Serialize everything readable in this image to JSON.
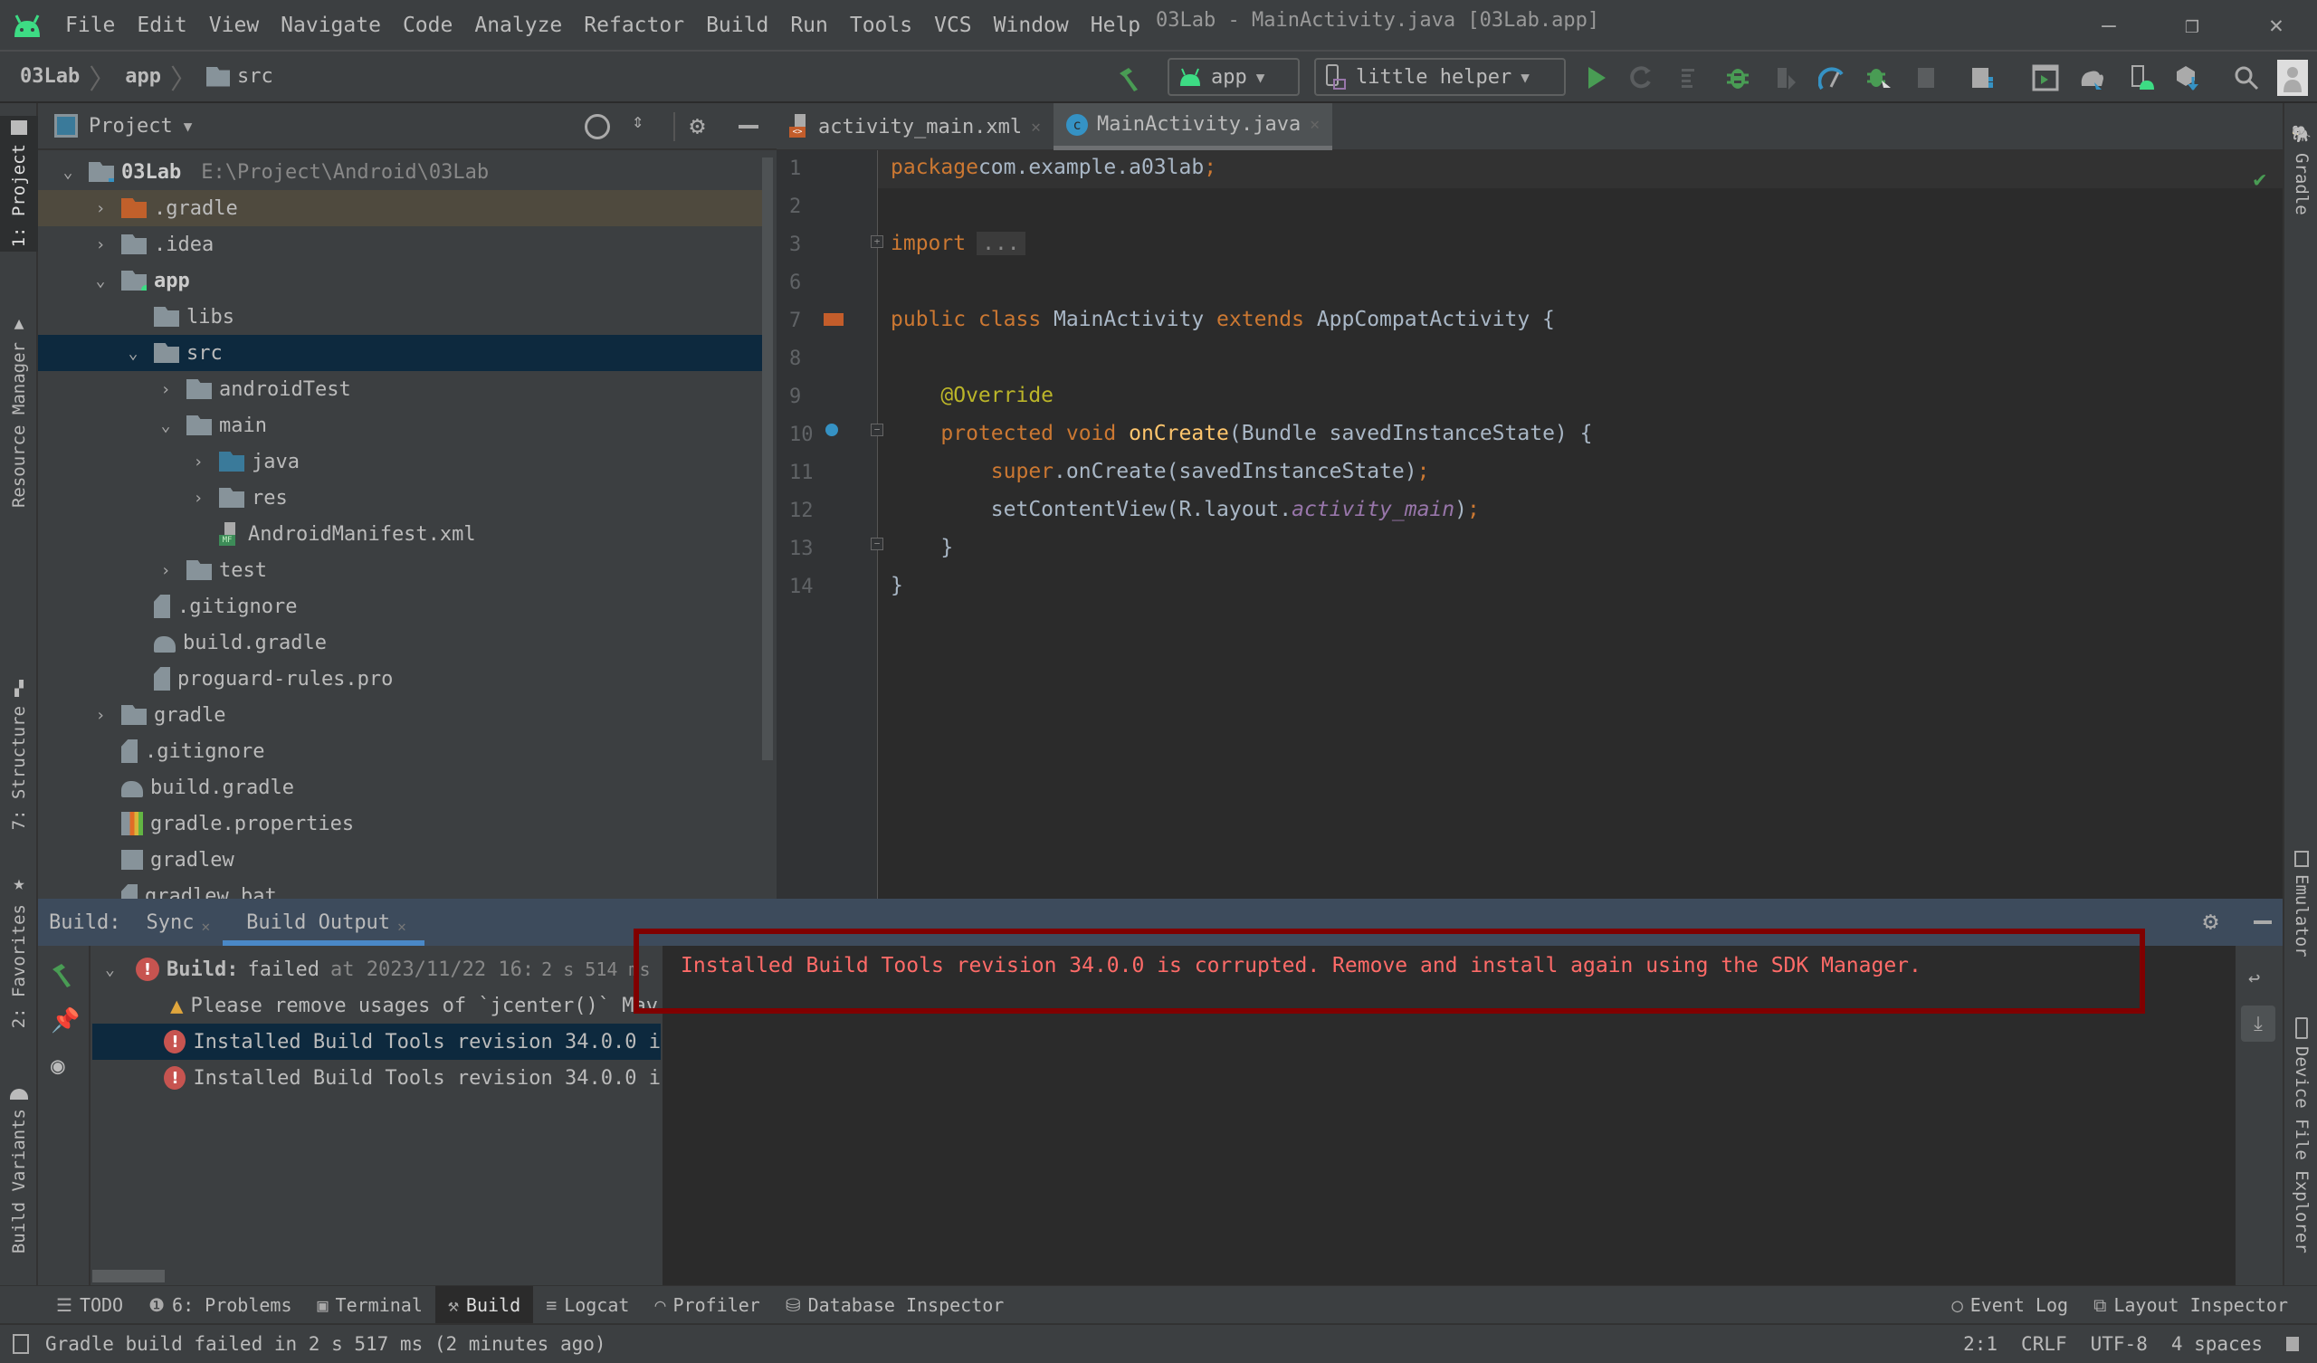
{
  "window": {
    "title": "03Lab - MainActivity.java [03Lab.app]",
    "controls": {
      "minimize": "–",
      "restore": "❐",
      "close": "✕"
    }
  },
  "menu": {
    "items": [
      {
        "label": "File",
        "mnemonic": "F"
      },
      {
        "label": "Edit",
        "mnemonic": "E"
      },
      {
        "label": "View",
        "mnemonic": "V"
      },
      {
        "label": "Navigate",
        "mnemonic": "N"
      },
      {
        "label": "Code",
        "mnemonic": "C"
      },
      {
        "label": "Analyze",
        "mnemonic": ""
      },
      {
        "label": "Refactor",
        "mnemonic": "R"
      },
      {
        "label": "Build",
        "mnemonic": "B"
      },
      {
        "label": "Run",
        "mnemonic": "u"
      },
      {
        "label": "Tools",
        "mnemonic": "T"
      },
      {
        "label": "VCS",
        "mnemonic": "S"
      },
      {
        "label": "Window",
        "mnemonic": "W"
      },
      {
        "label": "Help",
        "mnemonic": "H"
      }
    ]
  },
  "breadcrumb": [
    "03Lab",
    "app",
    "src"
  ],
  "toolbar": {
    "run_config": "app",
    "device": "little helper",
    "icons": [
      "make-project",
      "run",
      "apply-changes-restart",
      "apply-code-changes",
      "debug",
      "attach-debugger",
      "profile",
      "debug-attach-process",
      "stop",
      "sync-project",
      "avd-manager",
      "gradle-sync",
      "device-manager",
      "sdk-manager",
      "search",
      "account"
    ]
  },
  "left_strip": {
    "tabs": [
      {
        "label": "1: Project",
        "icon": "folder-icon"
      },
      {
        "label": "Resource Manager",
        "icon": "resources-icon"
      },
      {
        "label": "7: Structure",
        "icon": "structure-icon"
      },
      {
        "label": "2: Favorites",
        "icon": "star-icon"
      },
      {
        "label": "Build Variants",
        "icon": "android-icon"
      }
    ]
  },
  "right_strip": {
    "tabs": [
      {
        "label": "Gradle",
        "icon": "gradle-icon"
      },
      {
        "label": "Emulator",
        "icon": "emulator-icon"
      },
      {
        "label": "Device File Explorer",
        "icon": "device-icon"
      }
    ]
  },
  "project_panel": {
    "title": "Project",
    "root_path": "E:\\Project\\Android\\03Lab",
    "tree": [
      {
        "label": "03Lab",
        "depth": 0,
        "expanded": true,
        "type": "module-root",
        "bold": true
      },
      {
        "label": ".gradle",
        "depth": 1,
        "expanded": false,
        "type": "folder-excluded",
        "highlighted": true
      },
      {
        "label": ".idea",
        "depth": 1,
        "expanded": false,
        "type": "folder"
      },
      {
        "label": "app",
        "depth": 1,
        "expanded": true,
        "type": "module",
        "bold": true
      },
      {
        "label": "libs",
        "depth": 2,
        "type": "folder"
      },
      {
        "label": "src",
        "depth": 2,
        "expanded": true,
        "type": "folder",
        "selected": true
      },
      {
        "label": "androidTest",
        "depth": 3,
        "expanded": false,
        "type": "folder"
      },
      {
        "label": "main",
        "depth": 3,
        "expanded": true,
        "type": "folder"
      },
      {
        "label": "java",
        "depth": 4,
        "expanded": false,
        "type": "folder-source"
      },
      {
        "label": "res",
        "depth": 4,
        "expanded": false,
        "type": "folder-res"
      },
      {
        "label": "AndroidManifest.xml",
        "depth": 4,
        "type": "manifest"
      },
      {
        "label": "test",
        "depth": 3,
        "expanded": false,
        "type": "folder"
      },
      {
        "label": ".gitignore",
        "depth": 2,
        "type": "ignore-file"
      },
      {
        "label": "build.gradle",
        "depth": 2,
        "type": "gradle-file"
      },
      {
        "label": "proguard-rules.pro",
        "depth": 2,
        "type": "text-file"
      },
      {
        "label": "gradle",
        "depth": 1,
        "expanded": false,
        "type": "folder"
      },
      {
        "label": ".gitignore",
        "depth": 1,
        "type": "ignore-file"
      },
      {
        "label": "build.gradle",
        "depth": 1,
        "type": "gradle-file"
      },
      {
        "label": "gradle.properties",
        "depth": 1,
        "type": "properties-file"
      },
      {
        "label": "gradlew",
        "depth": 1,
        "type": "script-file"
      },
      {
        "label": "gradlew.bat",
        "depth": 1,
        "type": "text-file"
      }
    ]
  },
  "editor": {
    "tabs": [
      {
        "label": "activity_main.xml",
        "active": false,
        "icon": "xml-layout-icon"
      },
      {
        "label": "MainActivity.java",
        "active": true,
        "icon": "java-class-icon"
      }
    ],
    "lines": [
      {
        "n": "1",
        "tokens": [
          [
            "kw",
            "package"
          ],
          [
            "",
            "com.example.a03lab"
          ],
          [
            "kw",
            ";"
          ]
        ]
      },
      {
        "n": "2",
        "tokens": []
      },
      {
        "n": "3",
        "tokens": [
          [
            "kw",
            "import"
          ],
          [
            "",
            ""
          ],
          [
            "fold",
            "..."
          ]
        ]
      },
      {
        "n": "6",
        "tokens": []
      },
      {
        "n": "7",
        "tokens": [
          [
            "kw",
            "public class "
          ],
          [
            "",
            "MainActivity "
          ],
          [
            "kw",
            "extends "
          ],
          [
            "",
            "AppCompatActivity {"
          ]
        ]
      },
      {
        "n": "8",
        "tokens": []
      },
      {
        "n": "9",
        "tokens": [
          [
            "",
            "    "
          ],
          [
            "ann",
            "@Override"
          ]
        ]
      },
      {
        "n": "10",
        "tokens": [
          [
            "",
            "    "
          ],
          [
            "kw",
            "protected void "
          ],
          [
            "fn",
            "onCreate"
          ],
          [
            "",
            "(Bundle savedInstanceState) {"
          ]
        ]
      },
      {
        "n": "11",
        "tokens": [
          [
            "",
            "        "
          ],
          [
            "kw",
            "super"
          ],
          [
            "",
            ".onCreate(savedInstanceState)"
          ],
          [
            "kw",
            ";"
          ]
        ]
      },
      {
        "n": "12",
        "tokens": [
          [
            "",
            "        setContentView(R.layout."
          ],
          [
            "it",
            "activity_main"
          ],
          [
            "",
            ")"
          ],
          [
            "kw",
            ";"
          ]
        ]
      },
      {
        "n": "13",
        "tokens": [
          [
            "",
            "    }"
          ]
        ]
      },
      {
        "n": "14",
        "tokens": [
          [
            "",
            "}"
          ]
        ]
      }
    ]
  },
  "build_panel": {
    "label": "Build:",
    "tabs": [
      {
        "label": "Sync",
        "active": false
      },
      {
        "label": "Build Output",
        "active": true
      }
    ],
    "tree": [
      {
        "status": "error",
        "bold_label": "Build:",
        "label": "failed",
        "detail": "at 2023/11/22 16:",
        "duration": "2 s 514 ms",
        "depth": 0,
        "expanded": true
      },
      {
        "status": "warning",
        "label": "Please remove usages of `jcenter()` Mav",
        "depth": 1
      },
      {
        "status": "error",
        "label": "Installed Build Tools revision 34.0.0 i",
        "depth": 1,
        "selected": true
      },
      {
        "status": "error",
        "label": "Installed Build Tools revision 34.0.0 i",
        "depth": 1
      }
    ],
    "output": "Installed Build Tools revision 34.0.0 is corrupted. Remove and install again using the SDK Manager."
  },
  "bottom_tabs": {
    "left": [
      {
        "label": "TODO",
        "icon": "list-icon"
      },
      {
        "label": "6: Problems",
        "icon": "problems-icon"
      },
      {
        "label": "Terminal",
        "icon": "terminal-icon"
      },
      {
        "label": "Build",
        "icon": "hammer-icon",
        "active": true
      },
      {
        "label": "Logcat",
        "icon": "logcat-icon"
      },
      {
        "label": "Profiler",
        "icon": "profiler-icon"
      },
      {
        "label": "Database Inspector",
        "icon": "database-icon"
      }
    ],
    "right": [
      {
        "label": "Event Log",
        "icon": "event-log-icon"
      },
      {
        "label": "Layout Inspector",
        "icon": "layout-inspector-icon"
      }
    ]
  },
  "status_bar": {
    "message": "Gradle build failed in 2 s 517 ms (2 minutes ago)",
    "position": "2:1",
    "line_separator": "CRLF",
    "encoding": "UTF-8",
    "indent": "4 spaces"
  },
  "colors": {
    "error": "#c75450",
    "error_text": "#ff6b68",
    "highlight_box": "#800000",
    "selection": "#0d293e",
    "accent": "#4a88c7",
    "android_green": "#3ddc84"
  }
}
